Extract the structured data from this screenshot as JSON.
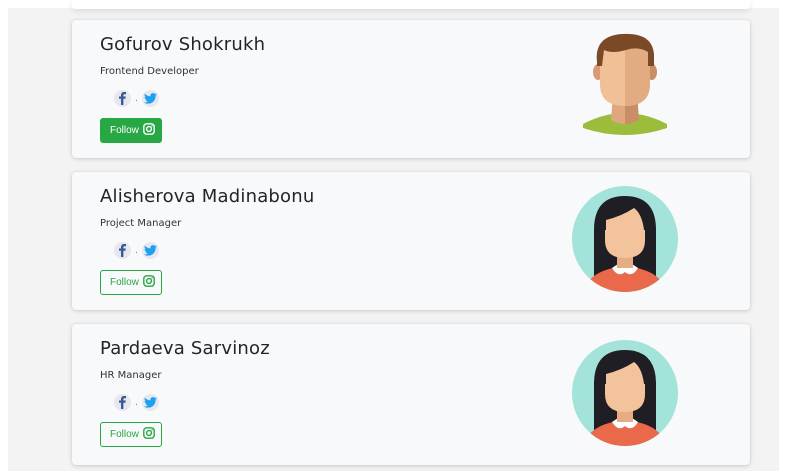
{
  "profiles": [
    {
      "name": "Gofurov Shokrukh",
      "role": "Frontend Developer",
      "follow_label": "Follow",
      "follow_style": "solid",
      "avatar": "male-avatar"
    },
    {
      "name": "Alisherova Madinabonu",
      "role": "Project Manager",
      "follow_label": "Follow",
      "follow_style": "outline",
      "avatar": "female-avatar"
    },
    {
      "name": "Pardaeva Sarvinoz",
      "role": "HR Manager",
      "follow_label": "Follow",
      "follow_style": "outline",
      "avatar": "female-avatar"
    }
  ],
  "icons": {
    "facebook": "facebook-icon",
    "twitter": "twitter-icon",
    "instagram": "instagram-icon",
    "separator": "."
  },
  "colors": {
    "accent_green": "#28a745",
    "facebook_blue": "#3b5998",
    "twitter_blue": "#1da1f2",
    "card_bg": "#f8f9fa",
    "page_bg": "#f3f3f3"
  }
}
